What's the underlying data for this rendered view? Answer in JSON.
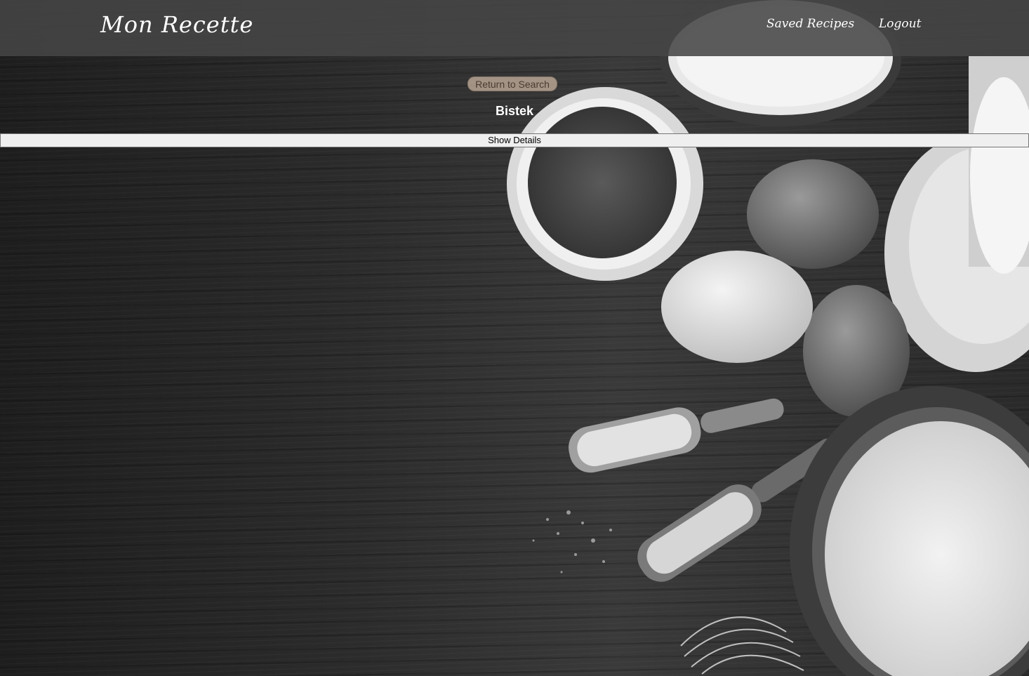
{
  "navbar": {
    "brand": "Mon Recette",
    "links": [
      {
        "label": "Saved Recipes"
      },
      {
        "label": "Logout"
      }
    ]
  },
  "main": {
    "return_button_label": "Return to Search",
    "recipe_title": "Bistek",
    "details_button_label": "Show Details"
  }
}
